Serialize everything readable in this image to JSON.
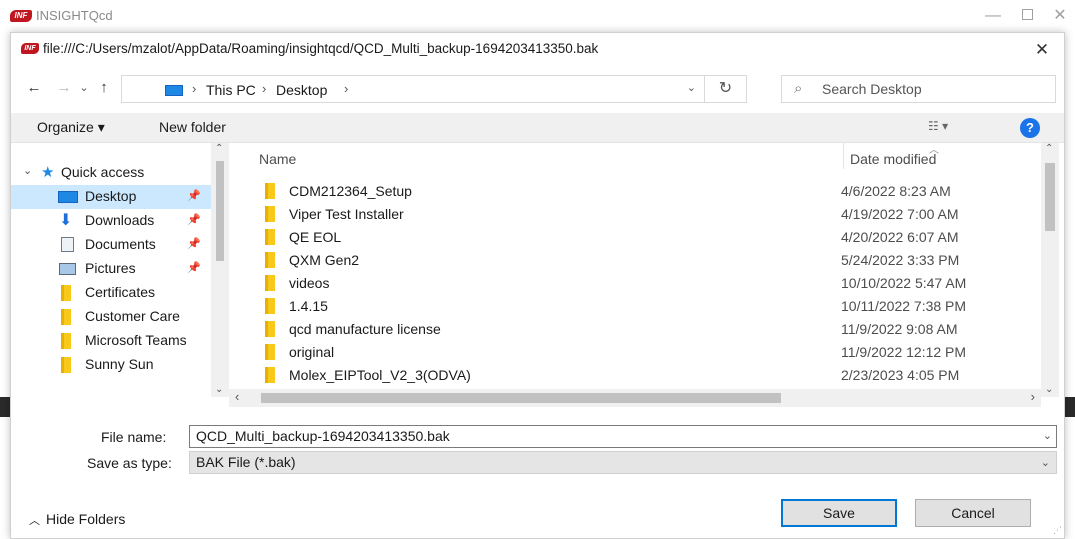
{
  "app": {
    "title": "INSIGHTQcd",
    "logo_text": "INF"
  },
  "dialog": {
    "title": "file:///C:/Users/mzalot/AppData/Roaming/insightqcd/QCD_Multi_backup-1694203413350.bak",
    "close": "✕"
  },
  "nav": {
    "back": "←",
    "forward": "→",
    "recent": "⌄",
    "up": "↑",
    "breadcrumb": [
      "This PC",
      "Desktop"
    ],
    "separator": "›",
    "refresh": "↻",
    "search_placeholder": "Search Desktop"
  },
  "commands": {
    "organize": "Organize ▾",
    "new_folder": "New folder",
    "view": "☷ ▾",
    "help": "?"
  },
  "sidebar": {
    "quick_access": "Quick access",
    "items": [
      {
        "label": "Desktop",
        "icon": "desktop-icon",
        "pinned": true,
        "selected": true
      },
      {
        "label": "Downloads",
        "icon": "download-icon",
        "pinned": true
      },
      {
        "label": "Documents",
        "icon": "documents-icon",
        "pinned": true
      },
      {
        "label": "Pictures",
        "icon": "pictures-icon",
        "pinned": true
      },
      {
        "label": "Certificates",
        "icon": "folder-icon"
      },
      {
        "label": "Customer Care",
        "icon": "folder-icon"
      },
      {
        "label": "Microsoft Teams",
        "icon": "folder-icon"
      },
      {
        "label": "Sunny Sun",
        "icon": "folder-icon"
      }
    ]
  },
  "filelist": {
    "col_name": "Name",
    "col_date": "Date modified",
    "rows": [
      {
        "name": "CDM212364_Setup",
        "date": "4/6/2022 8:23 AM"
      },
      {
        "name": "Viper Test Installer",
        "date": "4/19/2022 7:00 AM"
      },
      {
        "name": "QE EOL",
        "date": "4/20/2022 6:07 AM"
      },
      {
        "name": "QXM Gen2",
        "date": "5/24/2022 3:33 PM"
      },
      {
        "name": "videos",
        "date": "10/10/2022 5:47 AM"
      },
      {
        "name": "1.4.15",
        "date": "10/11/2022 7:38 PM"
      },
      {
        "name": "qcd manufacture license",
        "date": "11/9/2022 9:08 AM"
      },
      {
        "name": "original",
        "date": "11/9/2022 12:12 PM"
      },
      {
        "name": "Molex_EIPTool_V2_3(ODVA)",
        "date": "2/23/2023 4:05 PM"
      }
    ]
  },
  "form": {
    "file_name_label": "File name:",
    "file_name_value": "QCD_Multi_backup-1694203413350.bak",
    "save_type_label": "Save as type:",
    "save_type_value": "BAK File (*.bak)"
  },
  "footer": {
    "hide_folders": "Hide Folders",
    "save": "Save",
    "cancel": "Cancel"
  },
  "colors": {
    "accent": "#0078d7",
    "selected_bg": "#cce8ff",
    "folder": "#f5c518",
    "brand_red": "#c0161f"
  }
}
